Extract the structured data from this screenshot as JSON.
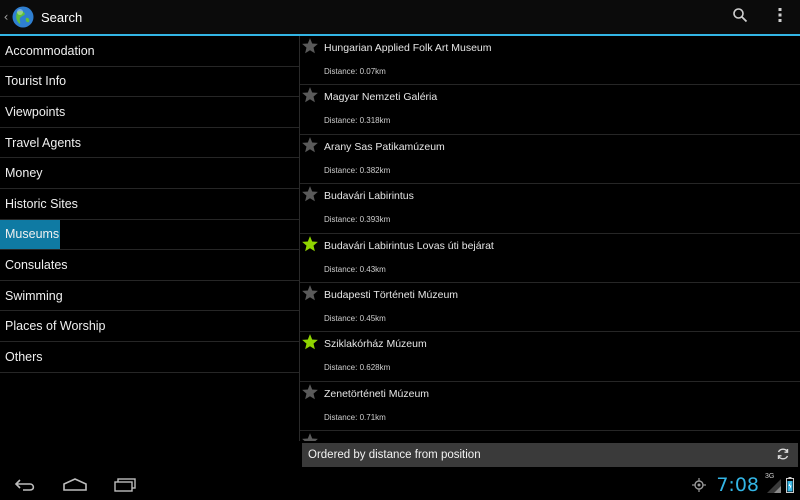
{
  "actionbar": {
    "title": "Search",
    "up_icon": "chevron-left-icon",
    "app_icon": "globe-icon",
    "actions": [
      {
        "name": "search-icon"
      },
      {
        "name": "overflow-menu-icon"
      }
    ]
  },
  "categories": [
    {
      "label": "Accommodation",
      "selected": false
    },
    {
      "label": "Tourist Info",
      "selected": false
    },
    {
      "label": "Viewpoints",
      "selected": false
    },
    {
      "label": "Travel Agents",
      "selected": false
    },
    {
      "label": "Money",
      "selected": false
    },
    {
      "label": "Historic Sites",
      "selected": false
    },
    {
      "label": "Museums",
      "selected": true
    },
    {
      "label": "Consulates",
      "selected": false
    },
    {
      "label": "Swimming",
      "selected": false
    },
    {
      "label": "Places of Worship",
      "selected": false
    },
    {
      "label": "Others",
      "selected": false
    }
  ],
  "pois": [
    {
      "name": "Hungarian Applied Folk Art Museum",
      "distance": "Distance: 0.07km",
      "favorite": false
    },
    {
      "name": "Magyar Nemzeti Galéria",
      "distance": "Distance: 0.318km",
      "favorite": false
    },
    {
      "name": "Arany Sas Patikamúzeum",
      "distance": "Distance: 0.382km",
      "favorite": false
    },
    {
      "name": "Budavári Labirintus",
      "distance": "Distance: 0.393km",
      "favorite": false
    },
    {
      "name": "Budavári Labirintus Lovas úti bejárat",
      "distance": "Distance: 0.43km",
      "favorite": true
    },
    {
      "name": "Budapesti Történeti Múzeum",
      "distance": "Distance: 0.45km",
      "favorite": false
    },
    {
      "name": "Sziklakórház Múzeum",
      "distance": "Distance: 0.628km",
      "favorite": true
    },
    {
      "name": "Zenetörténeti Múzeum",
      "distance": "Distance: 0.71km",
      "favorite": false
    }
  ],
  "order_bar": {
    "text": "Ordered by distance from position",
    "icon": "refresh-icon"
  },
  "system": {
    "time": "7:08",
    "network": "3G",
    "colors": {
      "accent": "#33b5e5",
      "selected": "#0f7aa3",
      "star_on": "#8fd400",
      "star_off": "#5a5a5a"
    }
  }
}
